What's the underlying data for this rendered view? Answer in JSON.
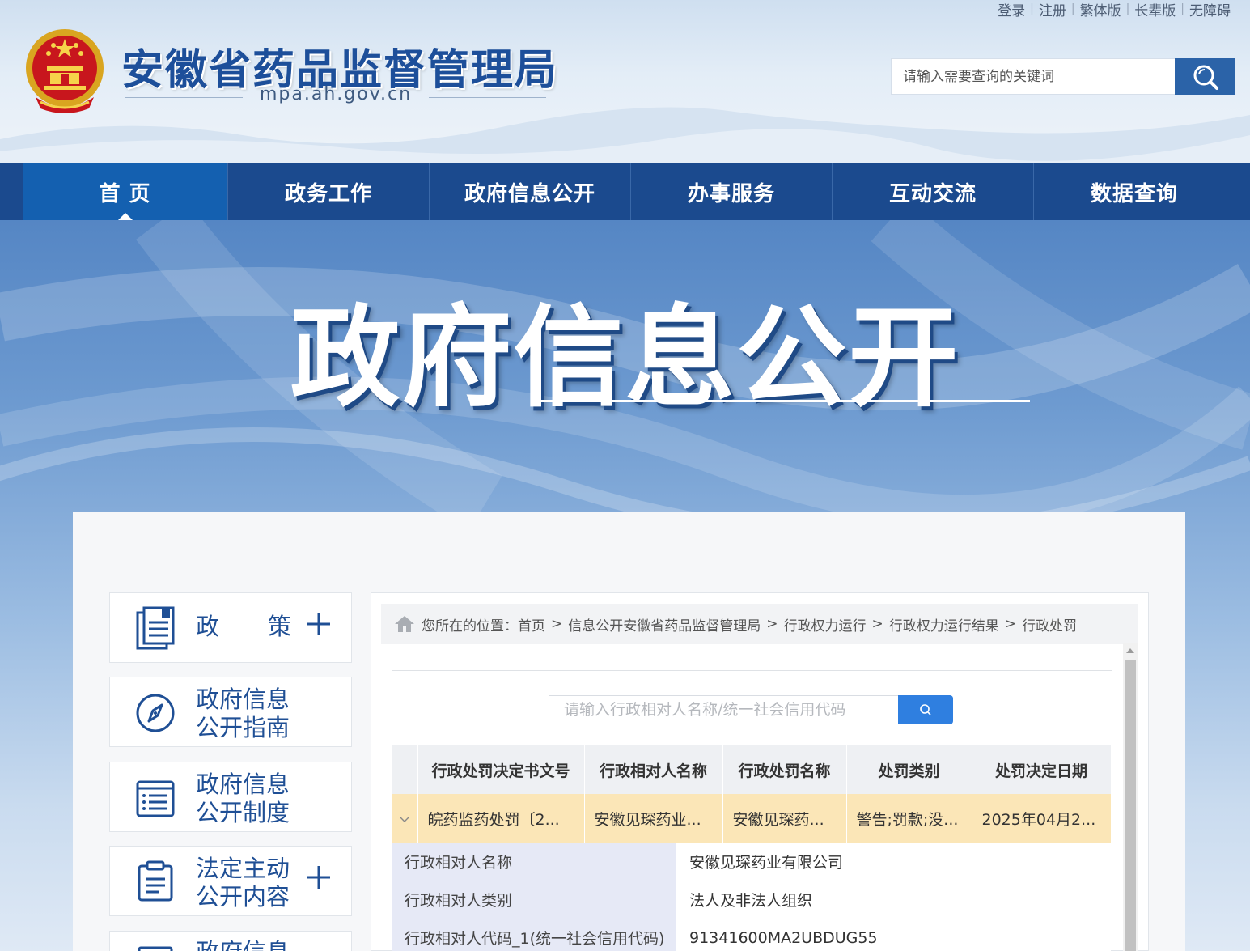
{
  "header": {
    "top_links": [
      "登录",
      "注册",
      "繁体版",
      "长辈版",
      "无障碍"
    ],
    "site_title": "安徽省药品监督管理局",
    "site_domain": "mpa.ah.gov.cn",
    "search_placeholder": "请输入需要查询的关键词",
    "search_icon": "search-icon"
  },
  "nav": {
    "items": [
      {
        "label": "首 页",
        "active": true
      },
      {
        "label": "政务工作"
      },
      {
        "label": "政府信息公开"
      },
      {
        "label": "办事服务"
      },
      {
        "label": "互动交流"
      },
      {
        "label": "数据查询"
      }
    ]
  },
  "banner": {
    "title": "政府信息公开"
  },
  "sidebar": {
    "items": [
      {
        "label_a": "政",
        "label_b": "策",
        "icon": "document-icon",
        "expandable": true
      },
      {
        "line1": "政府信息",
        "line2": "公开指南",
        "icon": "compass-icon"
      },
      {
        "line1": "政府信息",
        "line2": "公开制度",
        "icon": "list-icon"
      },
      {
        "line1": "法定主动",
        "line2": "公开内容",
        "icon": "clipboard-icon",
        "expandable": true
      },
      {
        "line1": "政府信息",
        "icon": "document-icon"
      }
    ]
  },
  "breadcrumb": {
    "prefix": "您所在的位置：",
    "items": [
      "首页",
      "信息公开安徽省药品监督管理局",
      "行政权力运行",
      "行政权力运行结果",
      "行政处罚"
    ],
    "separator": ">"
  },
  "query": {
    "placeholder": "请输入行政相对人名称/统一社会信用代码"
  },
  "table": {
    "headers": [
      "行政处罚决定书文号",
      "行政相对人名称",
      "行政处罚名称",
      "处罚类别",
      "处罚决定日期"
    ],
    "row": [
      "皖药监药处罚〔2...",
      "安徽见琛药业...",
      "安徽见琛药...",
      "警告;罚款;没...",
      "2025年04月2..."
    ]
  },
  "detail": [
    {
      "key": "行政相对人名称",
      "value": "安徽见琛药业有限公司"
    },
    {
      "key": "行政相对人类别",
      "value": "法人及非法人组织"
    },
    {
      "key": "行政相对人代码_1(统一社会信用代码)",
      "value": "91341600MA2UBDUG55"
    }
  ],
  "colors": {
    "nav_bg": "#1b4a8e",
    "nav_active": "#1460b0",
    "title_blue": "#1d4f9a",
    "row_highlight": "#fbe6b7",
    "detail_key_bg": "#e6e9f6",
    "query_button": "#2f7fe0"
  }
}
